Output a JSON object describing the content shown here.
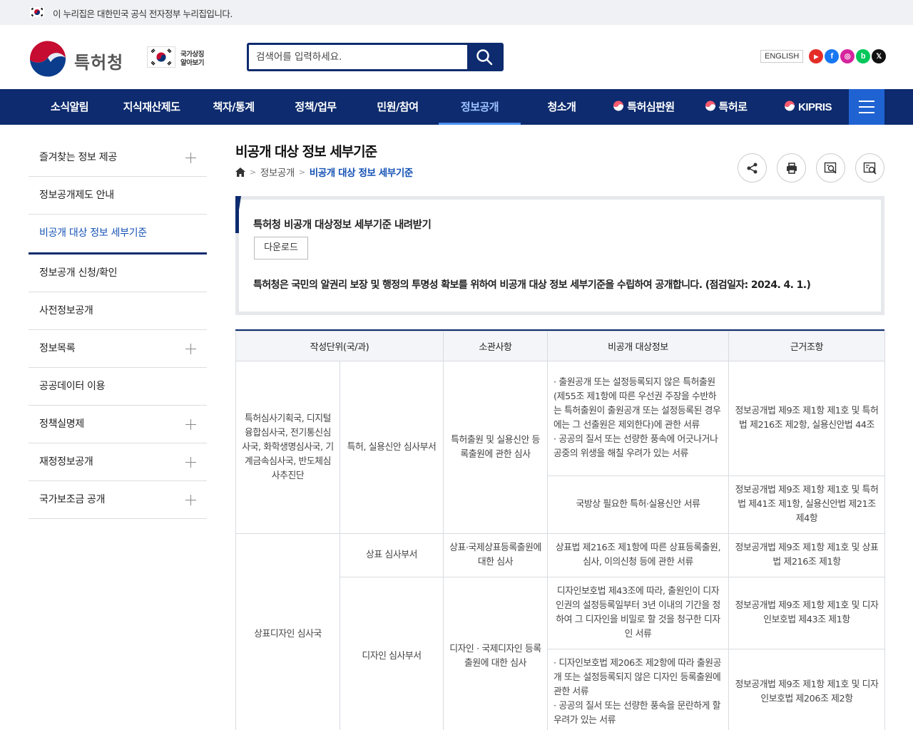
{
  "govbar": {
    "text": "이 누리집은 대한민국 공식 전자정부 누리집입니다."
  },
  "header": {
    "logo_name": "특허청",
    "national_symbol_line1": "국가상징",
    "national_symbol_line2": "알아보기",
    "search_placeholder": "검색어를 입력하세요.",
    "english_label": "ENGLISH",
    "sns": [
      {
        "name": "youtube",
        "glyph": "▶",
        "color": "#e52d27"
      },
      {
        "name": "facebook",
        "glyph": "f",
        "color": "#1877f2"
      },
      {
        "name": "instagram",
        "glyph": "◎",
        "color": "#d6249f"
      },
      {
        "name": "blog",
        "glyph": "b",
        "color": "#03c75a"
      },
      {
        "name": "x",
        "glyph": "𝕏",
        "color": "#111111"
      }
    ]
  },
  "gnb": {
    "items": [
      "소식알림",
      "지식재산제도",
      "책자/통계",
      "정책/업무",
      "민원/참여",
      "정보공개",
      "청소개",
      "특허심판원",
      "특허로",
      "KIPRIS"
    ],
    "active_index": 5
  },
  "lnb": {
    "items": [
      {
        "label": "즐겨찾는 정보 제공",
        "expandable": true
      },
      {
        "label": "정보공개제도 안내",
        "expandable": false
      },
      {
        "label": "비공개 대상 정보 세부기준",
        "expandable": false,
        "active": true
      },
      {
        "label": "정보공개 신청/확인",
        "expandable": false
      },
      {
        "label": "사전정보공개",
        "expandable": false
      },
      {
        "label": "정보목록",
        "expandable": true
      },
      {
        "label": "공공데이터 이용",
        "expandable": false
      },
      {
        "label": "정책실명제",
        "expandable": true
      },
      {
        "label": "재정정보공개",
        "expandable": true
      },
      {
        "label": "국가보조금 공개",
        "expandable": true
      }
    ]
  },
  "page": {
    "title": "비공개 대상 정보 세부기준",
    "breadcrumb": [
      "정보공개",
      "비공개 대상 정보 세부기준"
    ]
  },
  "infobox": {
    "heading": "특허청 비공개 대상정보 세부기준 내려받기",
    "download_label": "다운로드",
    "description": "특허청은 국민의 알권리 보장 및 행정의 투명성 확보를 위하여 비공개 대상 정보 세부기준을 수립하여 공개합니다. (점검일자: 2024. 4. 1.)"
  },
  "table": {
    "headers": [
      "작성단위(국/과)",
      "소관사항",
      "비공개 대상정보",
      "근거조항"
    ],
    "r1_unit": "특허심사기획국, 디지털융합심사국, 전기통신심사국, 화학생명심사국, 기계금속심사국, 반도체심사추진단",
    "r1_dept": "특허, 실용신안 심사부서",
    "r1_matter": "특허출원 및 실용신안 등록출원에 관한 심사",
    "r1_info": "· 출원공개 또는 설정등록되지 않은 특허출원(제55조 제1항에 따른 우선권 주장을 수반하는 특허출원이 출원공개 또는 설정등록된 경우에는 그 선출원은 제외한다)에 관한 서류\n· 공공의 질서 또는 선량한 풍속에 어긋나거나 공중의 위생을 해칠 우려가 있는 서류",
    "r1_basis": "정보공개법 제9조 제1항 제1호 및 특허법 제216조 제2항, 실용신안법 44조",
    "r2_info": "국방상 필요한 특허·실용신안 서류",
    "r2_basis": "정보공개법 제9조 제1항 제1호 및 특허법 제41조 제1항, 실용신안법 제21조 제4항",
    "r3_unit": "상표디자인 심사국",
    "r3_dept": "상표 심사부서",
    "r3_matter": "상표·국제상표등록출원에 대한 심사",
    "r3_info": "상표법 제216조 제1항에 따른 상표등록출원, 심사, 이의신청 등에 관한 서류",
    "r3_basis": "정보공개법 제9조 제1항 제1호 및 상표법 제216조 제1항",
    "r4_dept": "디자인 심사부서",
    "r4_matter": "디자인 · 국제디자인 등록출원에 대한 심사",
    "r4_info": "디자인보호법 제43조에 따라, 출원인이 디자인권의 설정등록일부터 3년 이내의 기간을 정하여 그 디자인을 비밀로 할 것을 청구한 디자인 서류",
    "r4_basis": "정보공개법 제9조 제1항 제1호 및 디자인보호법 제43조 제1항",
    "r5_info": "· 디자인보호법 제206조 제2항에 따라 출원공개 또는 설정등록되지 않은 디자인 등록출원에 관한 서류\n· 공공의 질서 또는 선량한 풍속을 문란하게 할 우려가 있는 서류",
    "r5_basis": "정보공개법 제9조 제1항 제1호 및 디자인보호법 제206조 제2항"
  }
}
